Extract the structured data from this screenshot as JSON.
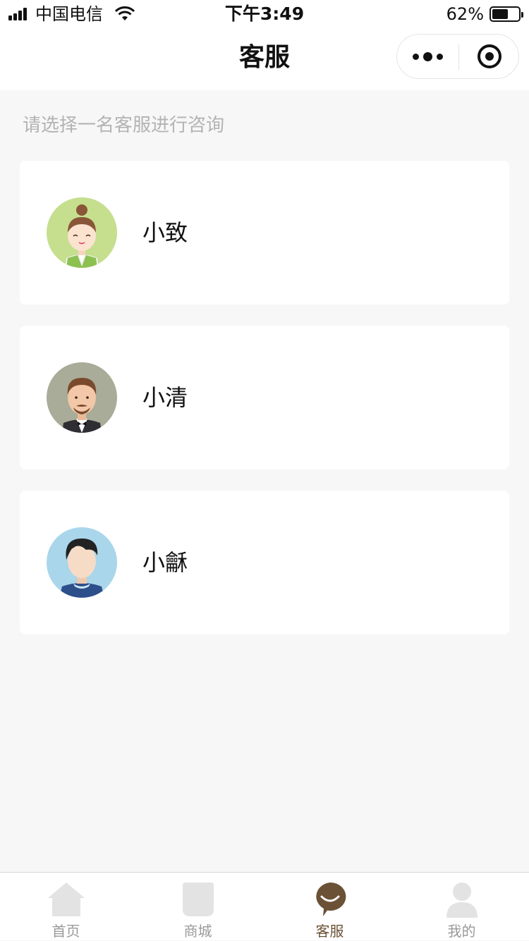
{
  "status_bar": {
    "carrier": "中国电信",
    "time": "下午3:49",
    "battery": "62%",
    "battery_level": 0.62
  },
  "navbar": {
    "title": "客服"
  },
  "subtitle": "请选择一名客服进行咨询",
  "agents": [
    {
      "name": "小致",
      "avatar": "female-agent-avatar"
    },
    {
      "name": "小清",
      "avatar": "bearded-agent-avatar"
    },
    {
      "name": "小龢",
      "avatar": "young-man-avatar"
    }
  ],
  "tabbar": {
    "items": [
      {
        "label": "首页",
        "icon": "home-icon"
      },
      {
        "label": "商城",
        "icon": "shop-icon"
      },
      {
        "label": "客服",
        "icon": "chat-icon",
        "active": true
      },
      {
        "label": "我的",
        "icon": "user-icon"
      }
    ]
  },
  "colors": {
    "accent": "#6b5135",
    "inactive": "#999999",
    "background": "#f7f7f7"
  }
}
